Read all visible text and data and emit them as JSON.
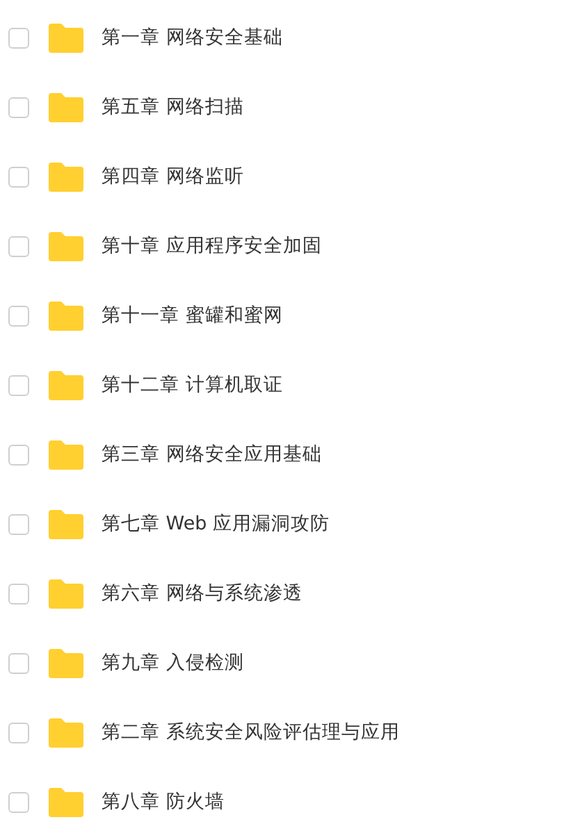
{
  "folders": [
    {
      "name": "第一章 网络安全基础",
      "checked": false
    },
    {
      "name": "第五章 网络扫描",
      "checked": false
    },
    {
      "name": "第四章 网络监听",
      "checked": false
    },
    {
      "name": "第十章 应用程序安全加固",
      "checked": false
    },
    {
      "name": "第十一章 蜜罐和蜜网",
      "checked": false
    },
    {
      "name": "第十二章 计算机取证",
      "checked": false
    },
    {
      "name": "第三章 网络安全应用基础",
      "checked": false
    },
    {
      "name": "第七章 Web 应用漏洞攻防",
      "checked": false
    },
    {
      "name": "第六章 网络与系统渗透",
      "checked": false
    },
    {
      "name": "第九章 入侵检测",
      "checked": false
    },
    {
      "name": "第二章 系统安全风险评估理与应用",
      "checked": false
    },
    {
      "name": "第八章 防火墙",
      "checked": false
    }
  ]
}
